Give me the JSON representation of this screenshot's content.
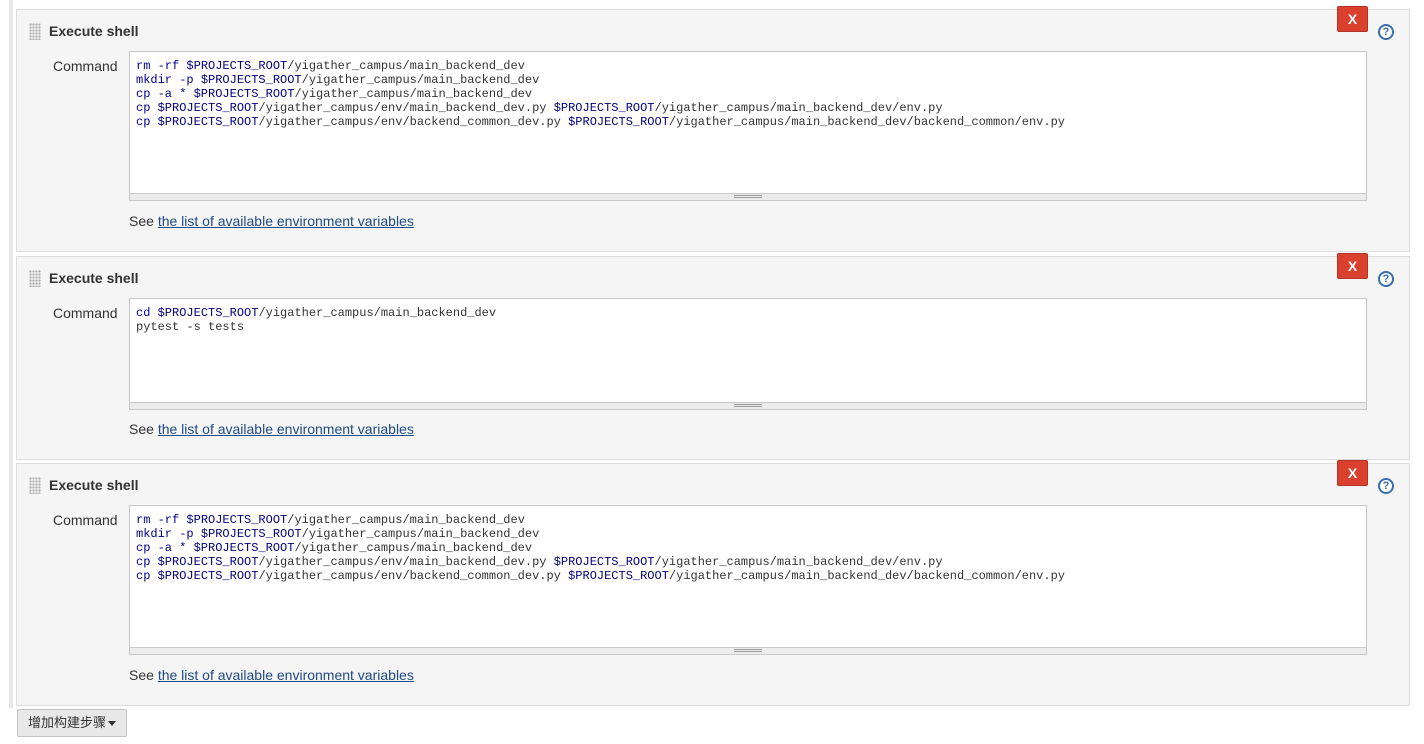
{
  "steps": [
    {
      "title": "Execute shell",
      "delete_label": "X",
      "help_label": "?",
      "field_label": "Command",
      "lines": [
        [
          [
            "kw",
            "rm -rf "
          ],
          [
            "var",
            "$PROJECTS_ROOT"
          ],
          [
            "t",
            "/yigather_campus/main_backend_dev"
          ]
        ],
        [
          [
            "kw",
            "mkdir -p "
          ],
          [
            "var",
            "$PROJECTS_ROOT"
          ],
          [
            "t",
            "/yigather_campus/main_backend_dev"
          ]
        ],
        [
          [
            "kw",
            "cp -a * "
          ],
          [
            "var",
            "$PROJECTS_ROOT"
          ],
          [
            "t",
            "/yigather_campus/main_backend_dev"
          ]
        ],
        [
          [
            "kw",
            "cp "
          ],
          [
            "var",
            "$PROJECTS_ROOT"
          ],
          [
            "t",
            "/yigather_campus/env/main_backend_dev.py "
          ],
          [
            "var",
            "$PROJECTS_ROOT"
          ],
          [
            "t",
            "/yigather_campus/main_backend_dev/env.py"
          ]
        ],
        [
          [
            "kw",
            "cp "
          ],
          [
            "var",
            "$PROJECTS_ROOT"
          ],
          [
            "t",
            "/yigather_campus/env/backend_common_dev.py "
          ],
          [
            "var",
            "$PROJECTS_ROOT"
          ],
          [
            "t",
            "/yigather_campus/main_backend_dev/backend_common/env.py"
          ]
        ]
      ],
      "see_prefix": "See ",
      "env_link": "the list of available environment variables"
    },
    {
      "title": "Execute shell",
      "delete_label": "X",
      "help_label": "?",
      "field_label": "Command",
      "lines": [
        [
          [
            "kw",
            "cd "
          ],
          [
            "var",
            "$PROJECTS_ROOT"
          ],
          [
            "t",
            "/yigather_campus/main_backend_dev"
          ]
        ],
        [
          [
            "t",
            "pytest -s tests"
          ]
        ]
      ],
      "see_prefix": "See ",
      "env_link": "the list of available environment variables"
    },
    {
      "title": "Execute shell",
      "delete_label": "X",
      "help_label": "?",
      "field_label": "Command",
      "lines": [
        [
          [
            "kw",
            "rm -rf "
          ],
          [
            "var",
            "$PROJECTS_ROOT"
          ],
          [
            "t",
            "/yigather_campus/main_backend_dev"
          ]
        ],
        [
          [
            "kw",
            "mkdir -p "
          ],
          [
            "var",
            "$PROJECTS_ROOT"
          ],
          [
            "t",
            "/yigather_campus/main_backend_dev"
          ]
        ],
        [
          [
            "kw",
            "cp -a * "
          ],
          [
            "var",
            "$PROJECTS_ROOT"
          ],
          [
            "t",
            "/yigather_campus/main_backend_dev"
          ]
        ],
        [
          [
            "kw",
            "cp "
          ],
          [
            "var",
            "$PROJECTS_ROOT"
          ],
          [
            "t",
            "/yigather_campus/env/main_backend_dev.py "
          ],
          [
            "var",
            "$PROJECTS_ROOT"
          ],
          [
            "t",
            "/yigather_campus/main_backend_dev/env.py"
          ]
        ],
        [
          [
            "kw",
            "cp "
          ],
          [
            "var",
            "$PROJECTS_ROOT"
          ],
          [
            "t",
            "/yigather_campus/env/backend_common_dev.py "
          ],
          [
            "var",
            "$PROJECTS_ROOT"
          ],
          [
            "t",
            "/yigather_campus/main_backend_dev/backend_common/env.py"
          ]
        ]
      ],
      "see_prefix": "See ",
      "env_link": "the list of available environment variables"
    }
  ],
  "add_step_button": {
    "label": "增加构建步骤",
    "icon": "caret-down-icon"
  },
  "colors": {
    "delete_button": "#d9412e",
    "help_icon": "#3b6ea8",
    "link": "#204a87",
    "panel_bg": "#f5f5f5",
    "keyword": "#00008b"
  }
}
